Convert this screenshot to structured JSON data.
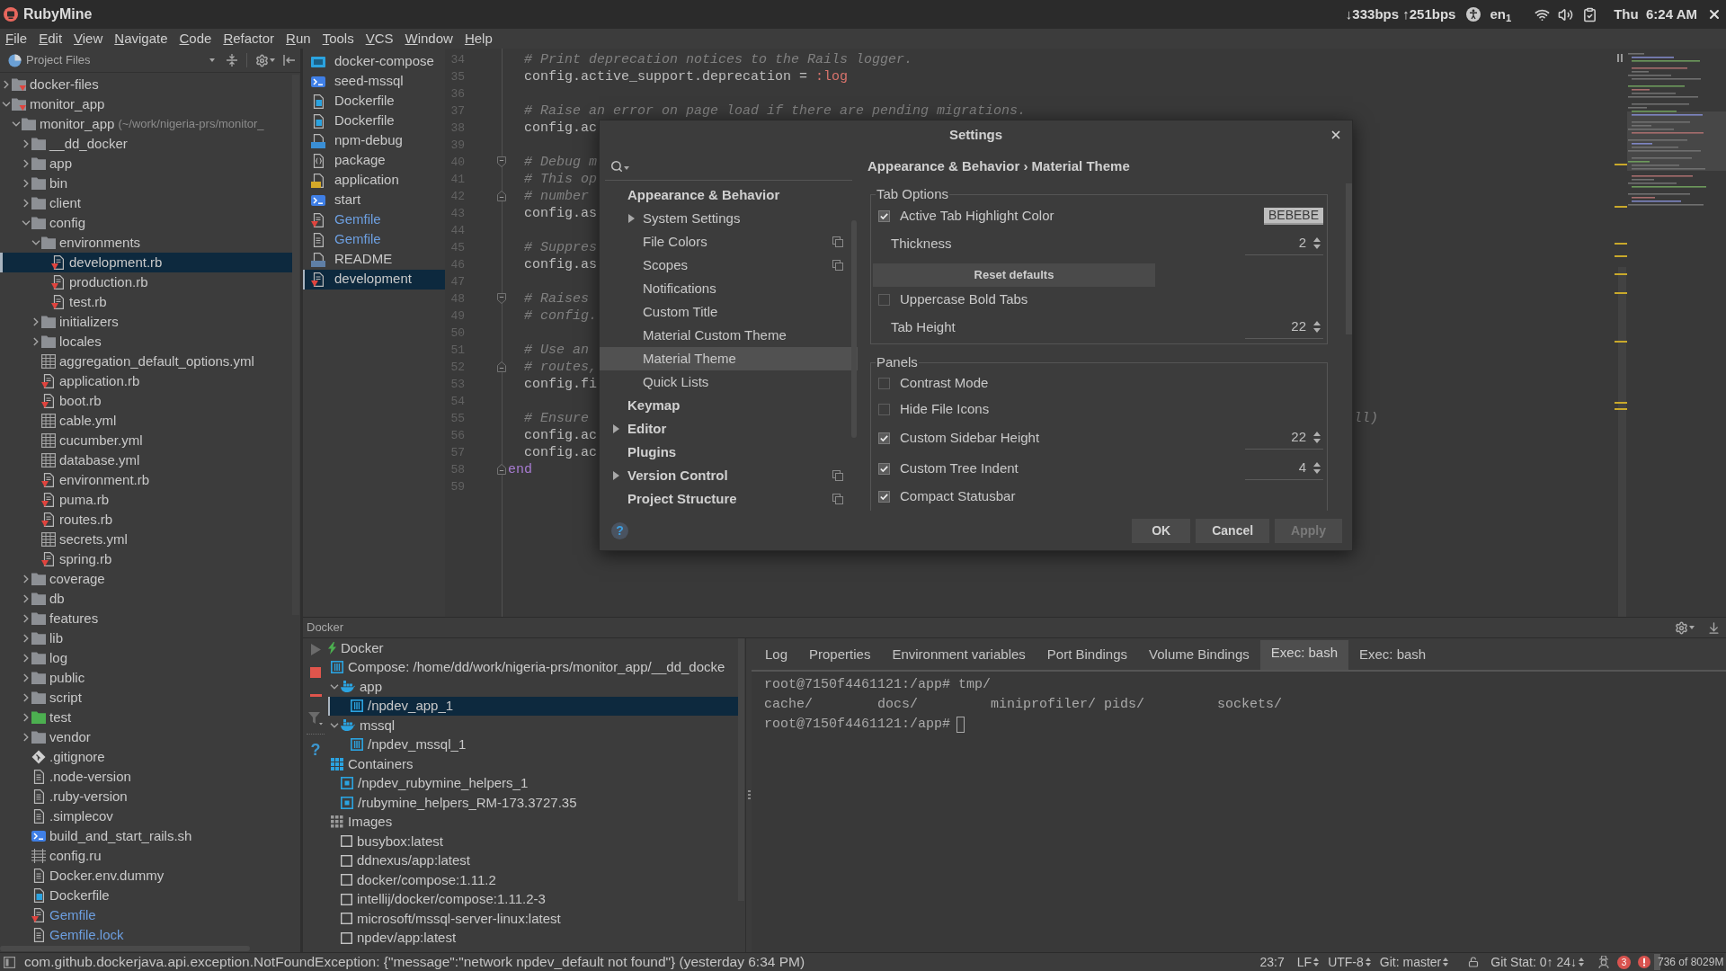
{
  "top_bar": {
    "app_name": "RubyMine",
    "network": "↓333bps ↑251bps",
    "keyboard": "en$_{1}$",
    "clock": "Thu  6:24 AM"
  },
  "menu": [
    "File",
    "Edit",
    "View",
    "Navigate",
    "Code",
    "Refactor",
    "Run",
    "Tools",
    "VCS",
    "Window",
    "Help"
  ],
  "project_panel": {
    "title": "Project Files",
    "tree": [
      {
        "name": "docker-files",
        "kind": "module",
        "expanded": false,
        "selected": false
      },
      {
        "name": "monitor_app",
        "kind": "module",
        "expanded": true,
        "selected": false,
        "children": [
          {
            "name": "monitor_app",
            "detail": "(~/work/nigeria-prs/monitor_",
            "kind": "folder",
            "expanded": true,
            "selected": false,
            "children": [
              {
                "name": "__dd_docker",
                "kind": "folder",
                "expanded": false,
                "selected": false,
                "modified": false
              },
              {
                "name": "app",
                "kind": "folder",
                "expanded": false,
                "selected": false,
                "modified": false
              },
              {
                "name": "bin",
                "kind": "folder",
                "expanded": false,
                "selected": false,
                "modified": false
              },
              {
                "name": "client",
                "kind": "folder",
                "expanded": false,
                "selected": false,
                "modified": false
              },
              {
                "name": "config",
                "kind": "folder",
                "expanded": true,
                "selected": false,
                "modified": false,
                "children": [
                  {
                    "name": "environments",
                    "kind": "folder",
                    "expanded": true,
                    "selected": false,
                    "children": [
                      {
                        "name": "development.rb",
                        "kind": "ruby",
                        "selected": true
                      },
                      {
                        "name": "production.rb",
                        "kind": "ruby",
                        "selected": false
                      },
                      {
                        "name": "test.rb",
                        "kind": "ruby",
                        "selected": false
                      }
                    ]
                  },
                  {
                    "name": "initializers",
                    "kind": "folder",
                    "expanded": false,
                    "selected": false
                  },
                  {
                    "name": "locales",
                    "kind": "folder",
                    "expanded": false,
                    "selected": false
                  },
                  {
                    "name": "aggregation_default_options.yml",
                    "kind": "yml",
                    "selected": false
                  },
                  {
                    "name": "application.rb",
                    "kind": "ruby",
                    "selected": false
                  },
                  {
                    "name": "boot.rb",
                    "kind": "ruby",
                    "selected": false
                  },
                  {
                    "name": "cable.yml",
                    "kind": "yml",
                    "selected": false
                  },
                  {
                    "name": "cucumber.yml",
                    "kind": "yml",
                    "selected": false
                  },
                  {
                    "name": "database.yml",
                    "kind": "yml",
                    "selected": false
                  },
                  {
                    "name": "environment.rb",
                    "kind": "ruby",
                    "selected": false
                  },
                  {
                    "name": "puma.rb",
                    "kind": "ruby",
                    "selected": false
                  },
                  {
                    "name": "routes.rb",
                    "kind": "ruby",
                    "selected": false
                  },
                  {
                    "name": "secrets.yml",
                    "kind": "yml",
                    "selected": false
                  },
                  {
                    "name": "spring.rb",
                    "kind": "ruby",
                    "selected": false
                  }
                ]
              },
              {
                "name": "coverage",
                "kind": "folder",
                "expanded": false,
                "selected": false,
                "modified": false
              },
              {
                "name": "db",
                "kind": "folder",
                "expanded": false,
                "selected": false,
                "modified": false
              },
              {
                "name": "features",
                "kind": "folder",
                "expanded": false,
                "selected": false,
                "modified": false
              },
              {
                "name": "lib",
                "kind": "folder",
                "expanded": false,
                "selected": false,
                "modified": false
              },
              {
                "name": "log",
                "kind": "folder",
                "expanded": false,
                "selected": false,
                "modified": false
              },
              {
                "name": "public",
                "kind": "folder",
                "expanded": false,
                "selected": false,
                "modified": false
              },
              {
                "name": "script",
                "kind": "folder",
                "expanded": false,
                "selected": false,
                "modified": false
              },
              {
                "name": "test",
                "kind": "test-folder",
                "expanded": false,
                "selected": false,
                "modified": false
              },
              {
                "name": "vendor",
                "kind": "folder",
                "expanded": false,
                "selected": false,
                "modified": false
              },
              {
                "name": ".gitignore",
                "kind": "git",
                "selected": false,
                "modified": false
              },
              {
                "name": ".node-version",
                "kind": "text",
                "selected": false,
                "modified": false
              },
              {
                "name": ".ruby-version",
                "kind": "text",
                "selected": false,
                "modified": false
              },
              {
                "name": ".simplecov",
                "kind": "text",
                "selected": false,
                "modified": false
              },
              {
                "name": "build_and_start_rails.sh",
                "kind": "shell",
                "selected": false,
                "modified": false
              },
              {
                "name": "config.ru",
                "kind": "config",
                "selected": false,
                "modified": false
              },
              {
                "name": "Docker.env.dummy",
                "kind": "text",
                "selected": false,
                "modified": false
              },
              {
                "name": "Dockerfile",
                "kind": "dockerfile",
                "selected": false,
                "modified": false
              },
              {
                "name": "Gemfile",
                "kind": "ruby",
                "selected": false,
                "modified": true
              },
              {
                "name": "Gemfile.lock",
                "kind": "text",
                "selected": false,
                "modified": true
              }
            ]
          }
        ]
      }
    ]
  },
  "open_files": [
    {
      "name": "docker-compose",
      "kind": "compose",
      "selected": false,
      "modified": false
    },
    {
      "name": "seed-mssql",
      "kind": "shell",
      "selected": false,
      "modified": false
    },
    {
      "name": "Dockerfile",
      "kind": "dockerfile",
      "selected": false,
      "modified": false
    },
    {
      "name": "Dockerfile",
      "kind": "dockerfile",
      "selected": false,
      "modified": false
    },
    {
      "name": "npm-debug",
      "kind": "log",
      "selected": false,
      "modified": false
    },
    {
      "name": "package",
      "kind": "json",
      "selected": false,
      "modified": false
    },
    {
      "name": "application",
      "kind": "js",
      "selected": false,
      "modified": false
    },
    {
      "name": "start",
      "kind": "shell",
      "selected": false,
      "modified": false
    },
    {
      "name": "Gemfile",
      "kind": "ruby",
      "selected": false,
      "modified": true
    },
    {
      "name": "Gemfile",
      "kind": "text",
      "selected": false,
      "modified": true
    },
    {
      "name": "README",
      "kind": "md",
      "selected": false,
      "modified": false
    },
    {
      "name": "development",
      "kind": "ruby",
      "selected": true,
      "modified": false
    }
  ],
  "editor": {
    "lines": [
      {
        "number": "34",
        "tokens": [
          {
            "kind": "comment",
            "text": "  # Print deprecation notices to the Rails logger."
          }
        ]
      },
      {
        "number": "35",
        "tokens": [
          {
            "kind": "plain",
            "text": "  config.active_support.deprecation = "
          },
          {
            "kind": "symbol",
            "text": ":log"
          }
        ]
      },
      {
        "number": "36"
      },
      {
        "number": "37",
        "tokens": [
          {
            "kind": "comment",
            "text": "  # Raise an error on page load if there are pending migrations."
          }
        ]
      },
      {
        "number": "38",
        "tokens": [
          {
            "kind": "plain",
            "text": "  config.ac"
          }
        ]
      },
      {
        "number": "39"
      },
      {
        "number": "40",
        "fold": {
          "kind": "start"
        },
        "tokens": [
          {
            "kind": "comment",
            "text": "  # Debug m"
          }
        ]
      },
      {
        "number": "41",
        "tokens": [
          {
            "kind": "comment",
            "text": "  # This op"
          }
        ]
      },
      {
        "number": "42",
        "fold": {
          "kind": "end"
        },
        "tokens": [
          {
            "kind": "comment",
            "text": "  # number"
          }
        ]
      },
      {
        "number": "43",
        "tokens": [
          {
            "kind": "plain",
            "text": "  config.as"
          }
        ]
      },
      {
        "number": "44"
      },
      {
        "number": "45",
        "tokens": [
          {
            "kind": "comment",
            "text": "  # Suppres"
          }
        ]
      },
      {
        "number": "46",
        "tokens": [
          {
            "kind": "plain",
            "text": "  config.as"
          }
        ]
      },
      {
        "number": "47"
      },
      {
        "number": "48",
        "fold": {
          "kind": "start"
        },
        "tokens": [
          {
            "kind": "comment",
            "text": "  # Raises"
          }
        ]
      },
      {
        "number": "49",
        "tokens": [
          {
            "kind": "comment",
            "text": "  # config."
          }
        ]
      },
      {
        "number": "50"
      },
      {
        "number": "51",
        "tokens": [
          {
            "kind": "comment",
            "text": "  # Use an"
          }
        ]
      },
      {
        "number": "52",
        "fold": {
          "kind": "end"
        },
        "tokens": [
          {
            "kind": "comment",
            "text": "  # routes,"
          }
        ]
      },
      {
        "number": "53",
        "tokens": [
          {
            "kind": "plain",
            "text": "  config.fi"
          }
        ]
      },
      {
        "number": "54"
      },
      {
        "number": "55",
        "tokens": [
          {
            "kind": "comment",
            "text": "  # Ensure"
          }
        ],
        "tail": "ll)"
      },
      {
        "number": "56",
        "tokens": [
          {
            "kind": "plain",
            "text": "  config.ac"
          }
        ]
      },
      {
        "number": "57",
        "tokens": [
          {
            "kind": "plain",
            "text": "  config.ac"
          }
        ]
      },
      {
        "number": "58",
        "fold": {
          "kind": "end"
        },
        "tokens": [
          {
            "kind": "keyword",
            "text": "end"
          }
        ]
      },
      {
        "number": "59"
      }
    ]
  },
  "settings": {
    "title": "Settings",
    "nav": [
      {
        "label": "Appearance & Behavior",
        "collapsed": false,
        "project_icon": false,
        "selected": false,
        "children": [
          {
            "label": "System Settings",
            "collapsed": true,
            "project_icon": false,
            "selected": false
          },
          {
            "label": "File Colors",
            "collapsed": false,
            "project_icon": true,
            "selected": false
          },
          {
            "label": "Scopes",
            "collapsed": false,
            "project_icon": true,
            "selected": false
          },
          {
            "label": "Notifications",
            "collapsed": false,
            "project_icon": false,
            "selected": false
          },
          {
            "label": "Custom Title",
            "collapsed": false,
            "project_icon": false,
            "selected": false
          },
          {
            "label": "Material Custom Theme",
            "collapsed": false,
            "project_icon": false,
            "selected": false
          },
          {
            "label": "Material Theme",
            "collapsed": false,
            "project_icon": false,
            "selected": true
          },
          {
            "label": "Quick Lists",
            "collapsed": false,
            "project_icon": false,
            "selected": false
          }
        ]
      },
      {
        "label": "Keymap",
        "collapsed": false,
        "project_icon": false,
        "selected": false
      },
      {
        "label": "Editor",
        "collapsed": true,
        "project_icon": false,
        "selected": false
      },
      {
        "label": "Plugins",
        "collapsed": false,
        "project_icon": false,
        "selected": false
      },
      {
        "label": "Version Control",
        "collapsed": true,
        "project_icon": true,
        "selected": false
      },
      {
        "label": "Project Structure",
        "collapsed": false,
        "project_icon": true,
        "selected": false
      }
    ],
    "breadcrumb": "Appearance & Behavior › Material Theme",
    "groups": [
      {
        "title": "Tab Options",
        "rows": [
          {
            "kind": "color",
            "label": "Active Tab Highlight Color",
            "checked": true,
            "value": "BEBEBE",
            "color": "#bebebe"
          },
          {
            "kind": "spinner",
            "label": "Thickness",
            "value": "2"
          },
          {
            "kind": "button",
            "label": "Reset defaults"
          },
          {
            "kind": "checkbox",
            "label": "Uppercase Bold Tabs",
            "checked": false
          },
          {
            "kind": "spinner",
            "label": "Tab Height",
            "value": "22"
          }
        ]
      },
      {
        "title": "Panels",
        "rows": [
          {
            "kind": "checkbox",
            "label": "Contrast Mode",
            "checked": false
          },
          {
            "kind": "checkbox",
            "label": "Hide File Icons",
            "checked": false
          },
          {
            "kind": "checkbox_spinner",
            "label": "Custom Sidebar Height",
            "checked": true,
            "value": "22"
          },
          {
            "kind": "checkbox_spinner",
            "label": "Custom Tree Indent",
            "checked": true,
            "value": "4"
          },
          {
            "kind": "checkbox",
            "label": "Compact Statusbar",
            "checked": true
          }
        ]
      }
    ],
    "help": "?",
    "buttons": [
      {
        "label": "OK",
        "disabled": false
      },
      {
        "label": "Cancel",
        "disabled": false
      },
      {
        "label": "Apply",
        "disabled": true
      }
    ]
  },
  "docker": {
    "title": "Docker",
    "help": "?",
    "tree": [
      {
        "name": "Docker",
        "kind": "docker",
        "selected": false,
        "children": [
          {
            "name": "Compose: /home/dd/work/nigeria-prs/monitor_app/__dd_docke",
            "kind": "compose",
            "selected": false,
            "children": [
              {
                "name": "app",
                "kind": "service",
                "expanded": true,
                "selected": false,
                "children": [
                  {
                    "name": "/npdev_app_1",
                    "kind": "compose-container",
                    "selected": true
                  }
                ]
              },
              {
                "name": "mssql",
                "kind": "service",
                "expanded": true,
                "selected": false,
                "children": [
                  {
                    "name": "/npdev_mssql_1",
                    "kind": "compose-container",
                    "selected": false
                  }
                ]
              }
            ]
          },
          {
            "name": "Containers",
            "kind": "containers",
            "selected": false,
            "children": [
              {
                "name": "/npdev_rubymine_helpers_1",
                "kind": "container",
                "selected": false
              },
              {
                "name": "/rubymine_helpers_RM-173.3727.35",
                "kind": "container",
                "selected": false
              }
            ]
          },
          {
            "name": "Images",
            "kind": "images",
            "selected": false,
            "children": [
              {
                "name": "busybox:latest",
                "kind": "image",
                "selected": false
              },
              {
                "name": "ddnexus/app:latest",
                "kind": "image",
                "selected": false
              },
              {
                "name": "docker/compose:1.11.2",
                "kind": "image",
                "selected": false
              },
              {
                "name": "intellij/docker/compose:1.11.2-3",
                "kind": "image",
                "selected": false
              },
              {
                "name": "microsoft/mssql-server-linux:latest",
                "kind": "image",
                "selected": false
              },
              {
                "name": "npdev/app:latest",
                "kind": "image",
                "selected": false
              }
            ]
          }
        ]
      }
    ],
    "tabs": [
      {
        "label": "Log",
        "selected": false
      },
      {
        "label": "Properties",
        "selected": false
      },
      {
        "label": "Environment variables",
        "selected": false
      },
      {
        "label": "Port Bindings",
        "selected": false
      },
      {
        "label": "Volume Bindings",
        "selected": false
      },
      {
        "label": "Exec: bash",
        "selected": true
      },
      {
        "label": "Exec: bash",
        "selected": false
      }
    ],
    "terminal": [
      {
        "kind": "text",
        "text": "root@7150f4461121:/app# tmp/",
        "cursor": false
      },
      {
        "kind": "columns",
        "items": [
          "cache/",
          "docs/",
          "miniprofiler/",
          "pids/",
          "sockets/"
        ],
        "cursor": false
      },
      {
        "kind": "text",
        "text": "root@7150f4461121:/app#",
        "cursor": true
      }
    ]
  },
  "status_bar": {
    "message": "com.github.dockerjava.api.exception.NotFoundException: {\"message\":\"network npdev_default not found\"} (yesterday 6:34 PM)",
    "position": "23:7",
    "line_separator": "LF",
    "encoding": "UTF-8",
    "branch": "Git: master",
    "git_stat": "Git Stat: 0↑ 24↓",
    "notifications": "3",
    "memory": {
      "text": "736 of 8029M",
      "level": 0.09
    }
  }
}
